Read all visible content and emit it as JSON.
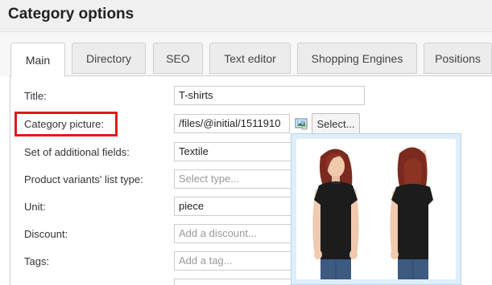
{
  "header": {
    "title": "Category options"
  },
  "tabs": [
    {
      "label": "Main",
      "active": true
    },
    {
      "label": "Directory",
      "active": false
    },
    {
      "label": "SEO",
      "active": false
    },
    {
      "label": "Text editor",
      "active": false
    },
    {
      "label": "Shopping Engines",
      "active": false
    },
    {
      "label": "Positions",
      "active": false
    }
  ],
  "form": {
    "title": {
      "label": "Title:",
      "value": "T-shirts"
    },
    "category_picture": {
      "label": "Category picture:",
      "value": "/files/@initial/1511910",
      "select_label": "Select...",
      "icon": "image-picker-icon"
    },
    "additional_fields": {
      "label": "Set of additional fields:",
      "value": "Textile"
    },
    "variants_list_type": {
      "label": "Product variants' list type:",
      "placeholder": "Select type..."
    },
    "unit": {
      "label": "Unit:",
      "value": "piece"
    },
    "discount": {
      "label": "Discount:",
      "placeholder": "Add a discount..."
    },
    "tags": {
      "label": "Tags:",
      "placeholder": "Add a tag..."
    }
  },
  "colors": {
    "highlight": "#e11b1b",
    "shirt": "#1c1c1c",
    "hair": "#7a2a1e",
    "skin": "#f0c9ae",
    "jeans": "#3d5a80",
    "popup_bg": "#ddeefa"
  }
}
